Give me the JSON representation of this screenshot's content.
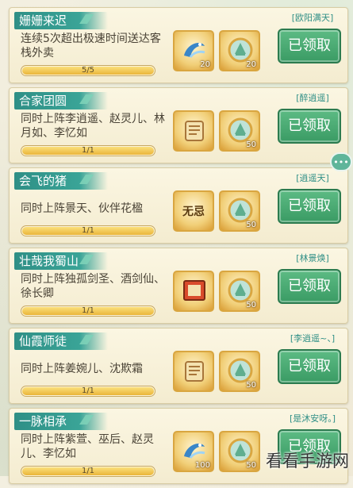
{
  "achievements": [
    {
      "title": "姗姗来迟",
      "description": "连续5次超出极速时间送达客栈外卖",
      "progress_text": "5/5",
      "progress_ratio": 1.0,
      "item1": {
        "icon": "fish-icon",
        "count": "20"
      },
      "item2": {
        "icon": "token-icon",
        "count": "20"
      },
      "player_name": "[欧阳满天]",
      "claim_label": "已领取"
    },
    {
      "title": "合家团圆",
      "description": "同时上阵李逍遥、赵灵儿、林月如、李忆如",
      "progress_text": "1/1",
      "progress_ratio": 1.0,
      "item1": {
        "icon": "scroll-icon",
        "count": ""
      },
      "item2": {
        "icon": "token-icon",
        "count": "50"
      },
      "player_name": "[醉逍遥]",
      "claim_label": "已领取"
    },
    {
      "title": "会飞的猪",
      "description": "同时上阵景天、伙伴花楹",
      "progress_text": "1/1",
      "progress_ratio": 1.0,
      "item1": {
        "icon": "wuji-icon",
        "label": "无忌",
        "count": ""
      },
      "item2": {
        "icon": "token-icon",
        "count": "50"
      },
      "player_name": "[逍遥天]",
      "claim_label": "已领取"
    },
    {
      "title": "壮哉我蜀山",
      "description": "同时上阵独孤剑圣、酒剑仙、徐长卿",
      "progress_text": "1/1",
      "progress_ratio": 1.0,
      "item1": {
        "icon": "book-icon",
        "count": ""
      },
      "item2": {
        "icon": "token-icon",
        "count": "50"
      },
      "player_name": "[林景焕]",
      "claim_label": "已领取"
    },
    {
      "title": "仙霞师徒",
      "description": "同时上阵姜婉儿、沈欺霜",
      "progress_text": "1/1",
      "progress_ratio": 1.0,
      "item1": {
        "icon": "scroll-icon",
        "count": ""
      },
      "item2": {
        "icon": "token-icon",
        "count": "50"
      },
      "player_name": "[李逍遥~、]",
      "claim_label": "已领取"
    },
    {
      "title": "一脉相承",
      "description": "同时上阵紫萱、巫后、赵灵儿、李忆如",
      "progress_text": "1/1",
      "progress_ratio": 1.0,
      "item1": {
        "icon": "fish-icon",
        "count": "100"
      },
      "item2": {
        "icon": "token-icon",
        "count": "50"
      },
      "player_name": "[是沐安呀。]",
      "claim_label": "已领取"
    }
  ],
  "chat_icon": "chat-icon",
  "watermark": "看看手游网",
  "colors": {
    "title_bar": "#2f8f86",
    "claim_button": "#3a9b64",
    "progress_fill": "#eab53a",
    "card_background": "#f7f0d8"
  }
}
